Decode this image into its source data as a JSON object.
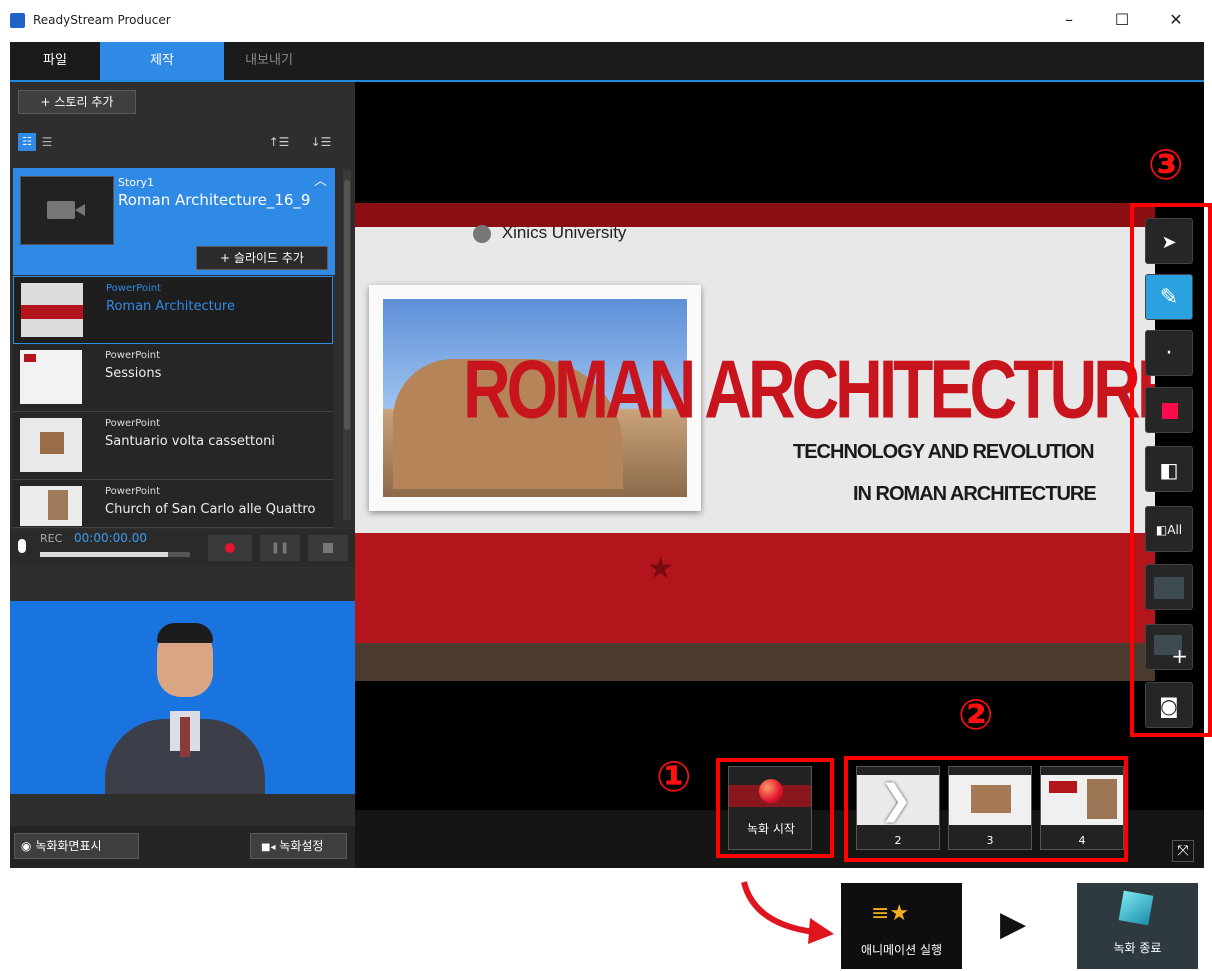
{
  "window": {
    "title": "ReadyStream Producer",
    "minimize": "–",
    "maximize": "☐",
    "close": "✕"
  },
  "menu": {
    "tabs": [
      {
        "label": "파일"
      },
      {
        "label": "제작"
      },
      {
        "label": "내보내기"
      }
    ],
    "active_index": 1
  },
  "left_panel": {
    "add_story": "+ 스토리 추가",
    "story": {
      "label": "Story1",
      "title": "Roman Architecture_16_9",
      "add_slide": "+ 슬라이드 추가"
    },
    "slides": [
      {
        "type": "PowerPoint",
        "name": "Roman Architecture",
        "selected": true
      },
      {
        "type": "PowerPoint",
        "name": "Sessions",
        "selected": false
      },
      {
        "type": "PowerPoint",
        "name": "Santuario volta cassettoni",
        "selected": false
      },
      {
        "type": "PowerPoint",
        "name": "Church of San Carlo alle Quattro",
        "selected": false
      }
    ],
    "recorder": {
      "rec_label": "REC",
      "time": "00:00:00.00",
      "level": 0.85
    },
    "show_record_screen": "녹화화면표시",
    "record_settings": "녹화설정"
  },
  "slide": {
    "university": "Xinics University",
    "title": "ROMAN ARCHITECTURE",
    "subtitle1": "TECHNOLOGY AND REVOLUTION",
    "subtitle2": "IN ROMAN ARCHITECTURE"
  },
  "tools": [
    {
      "name": "pointer-icon",
      "glyph": "➤"
    },
    {
      "name": "pen-icon",
      "glyph": "✎",
      "active": true
    },
    {
      "name": "pen-size-icon",
      "glyph": "·"
    },
    {
      "name": "color-swatch-icon",
      "glyph": "■"
    },
    {
      "name": "eraser-icon",
      "glyph": "◧"
    },
    {
      "name": "erase-all-icon",
      "glyph": "All"
    },
    {
      "name": "background-icon",
      "glyph": "▭"
    },
    {
      "name": "add-background-icon",
      "glyph": "+"
    },
    {
      "name": "screenshot-icon",
      "glyph": "◙"
    }
  ],
  "bottom": {
    "record_start": "녹화 시작",
    "thumbs": [
      {
        "num": "2"
      },
      {
        "num": "3"
      },
      {
        "num": "4"
      }
    ]
  },
  "callouts": {
    "one": "①",
    "two": "②",
    "three": "③"
  },
  "legend": {
    "animation": "애니메이션 실행",
    "arrow": "▶",
    "record_end": "녹화 종료"
  },
  "colors": {
    "accent": "#2f8ae6",
    "annotation_red": "#ff0000",
    "slide_red": "#b4141c"
  }
}
